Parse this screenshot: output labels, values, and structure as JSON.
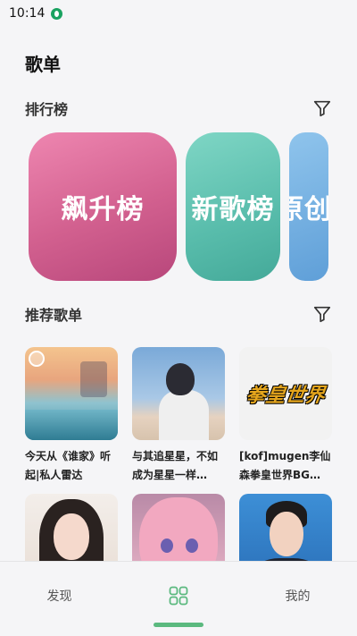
{
  "status_bar": {
    "time": "10:14"
  },
  "page": {
    "title": "歌单"
  },
  "rank_section": {
    "title": "排行榜",
    "cards": [
      {
        "label": "飙升榜"
      },
      {
        "label": "新歌榜"
      },
      {
        "label": "原创"
      }
    ]
  },
  "recommend_section": {
    "title": "推荐歌单",
    "playlists": [
      {
        "title": "今天从《谁家》听起|私人雷达"
      },
      {
        "title": "与其追星星，不如成为星星一样…"
      },
      {
        "title": "[kof]mugen李仙森拳皇世界BG…"
      },
      {
        "title": ""
      },
      {
        "title": ""
      },
      {
        "title": ""
      }
    ],
    "cover_c_logo": "拳皇世界"
  },
  "bottom_nav": {
    "items": [
      {
        "label": "发现"
      },
      {
        "label": ""
      },
      {
        "label": "我的"
      }
    ],
    "active_index": 1
  },
  "colors": {
    "accent_green": "#5bb97f",
    "rank_pink": "#d2608f",
    "rank_teal": "#58bcab",
    "rank_blue": "#5f9fd8"
  }
}
